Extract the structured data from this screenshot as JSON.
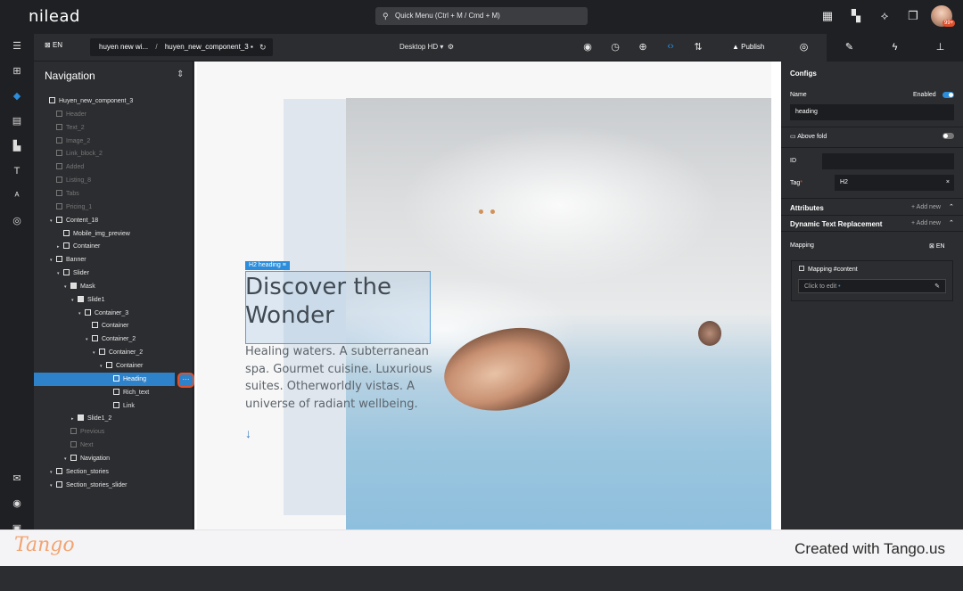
{
  "app": {
    "logo_text": "nilead",
    "quick_menu": "Quick Menu (Ctrl + M / Cmd + M)",
    "avatar_badge": "99+"
  },
  "topbar_icons": [
    "calendar-icon",
    "grid-icon",
    "share-icon",
    "windows-icon"
  ],
  "iconrail": [
    "collapse-icon",
    "add-icon",
    "layers-icon",
    "page-icon",
    "components-icon",
    "typography-icon",
    "translate-icon",
    "database-icon"
  ],
  "iconrail_bottom": [
    "mail-icon",
    "discord-icon",
    "gift-icon"
  ],
  "toolbar": {
    "lang": "EN",
    "breadcrumb_site": "huyen new wi...",
    "breadcrumb_sep": "/",
    "breadcrumb_page": "huyen_new_component_3",
    "device": "Desktop HD",
    "publish": "Publish"
  },
  "navigation": {
    "title": "Navigation",
    "tree": [
      {
        "label": "Huyen_new_component_3",
        "level": 0,
        "dim": false
      },
      {
        "label": "Header",
        "level": 1,
        "dim": true
      },
      {
        "label": "Text_2",
        "level": 1,
        "dim": true
      },
      {
        "label": "Image_2",
        "level": 1,
        "dim": true
      },
      {
        "label": "Link_block_2",
        "level": 1,
        "dim": true
      },
      {
        "label": "Added",
        "level": 1,
        "dim": true
      },
      {
        "label": "Listing_8",
        "level": 1,
        "dim": true
      },
      {
        "label": "Tabs",
        "level": 1,
        "dim": true
      },
      {
        "label": "Pricing_1",
        "level": 1,
        "dim": true
      },
      {
        "label": "Content_18",
        "level": 1,
        "dim": false
      },
      {
        "label": "Mobile_img_preview",
        "level": 2,
        "dim": false
      },
      {
        "label": "Container",
        "level": 2,
        "dim": false
      },
      {
        "label": "Banner",
        "level": 1,
        "dim": false
      },
      {
        "label": "Slider",
        "level": 2,
        "dim": false
      },
      {
        "label": "Mask",
        "level": 3,
        "dim": false
      },
      {
        "label": "Slide1",
        "level": 4,
        "dim": false
      },
      {
        "label": "Container_3",
        "level": 5,
        "dim": false
      },
      {
        "label": "Container",
        "level": 6,
        "dim": false
      },
      {
        "label": "Container_2",
        "level": 6,
        "dim": false
      },
      {
        "label": "Container_2",
        "level": 7,
        "dim": false
      },
      {
        "label": "Container",
        "level": 8,
        "dim": false
      },
      {
        "label": "Heading",
        "level": 9,
        "dim": false,
        "selected": true
      },
      {
        "label": "Rich_text",
        "level": 9,
        "dim": false
      },
      {
        "label": "Link",
        "level": 9,
        "dim": false
      },
      {
        "label": "Slide1_2",
        "level": 4,
        "dim": false
      },
      {
        "label": "Previous",
        "level": 3,
        "dim": true
      },
      {
        "label": "Next",
        "level": 3,
        "dim": true
      },
      {
        "label": "Navigation",
        "level": 3,
        "dim": false
      },
      {
        "label": "Section_stories",
        "level": 1,
        "dim": false
      },
      {
        "label": "Section_stories_slider",
        "level": 1,
        "dim": false
      }
    ]
  },
  "canvas": {
    "heading_tag": "H2 heading",
    "heading": "Discover the Wonder",
    "richtext": "Healing waters. A subterranean spa. Gourmet cuisine. Luxurious suites. Otherworldly vistas. A universe of radiant wellbeing.",
    "link_arrow": "↓"
  },
  "configs": {
    "title": "Configs",
    "name_label": "Name",
    "enabled_label": "Enabled",
    "name_value": "heading",
    "above_fold": "Above fold",
    "id_label": "ID",
    "id_value": "",
    "tag_label": "Tag",
    "tag_value": "H2",
    "attributes": "Attributes",
    "add_new": "+ Add new",
    "dynamic_text": "Dynamic Text Replacement",
    "mapping": "Mapping",
    "mapping_lang": "EN",
    "mapping_content": "Mapping #content",
    "click_to_edit": "Click to edit"
  },
  "footer": {
    "brand": "Tango",
    "created": "Created with Tango.us"
  },
  "colors": {
    "accent": "#2b8ddb",
    "highlight": "#e0502d",
    "dark": "#1f2023",
    "panel": "#2b2d30"
  }
}
